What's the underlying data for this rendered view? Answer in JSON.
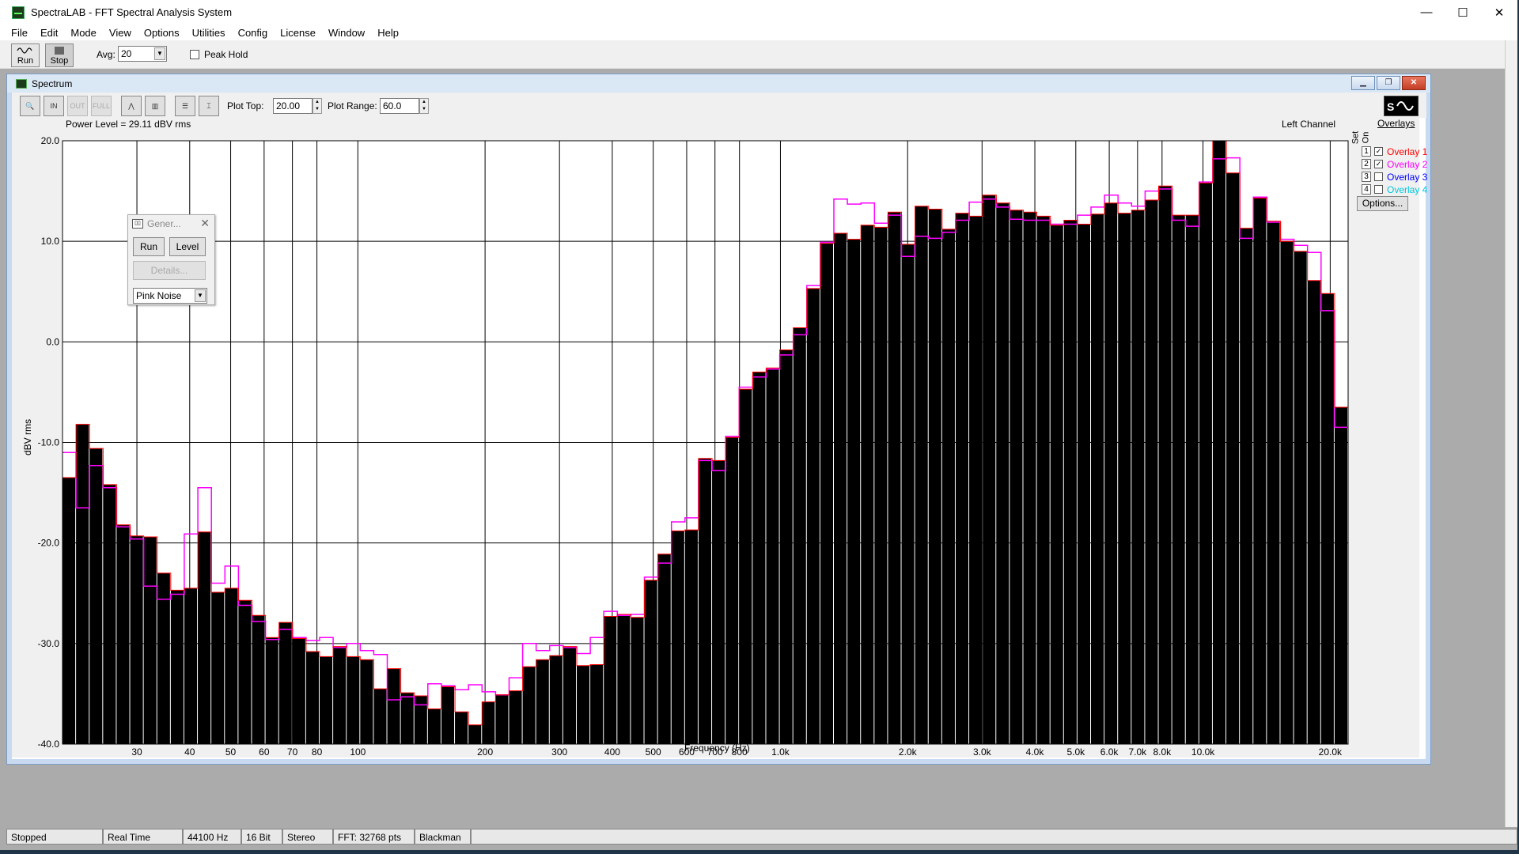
{
  "app": {
    "title": "SpectraLAB - FFT Spectral Analysis System",
    "window_controls": [
      "—",
      "☐",
      "✕"
    ]
  },
  "menu": [
    "File",
    "Edit",
    "Mode",
    "View",
    "Options",
    "Utilities",
    "Config",
    "License",
    "Window",
    "Help"
  ],
  "toolbar": {
    "run_label": "Run",
    "stop_label": "Stop",
    "avg_label": "Avg:",
    "avg_value": "20",
    "peak_hold_label": "Peak Hold",
    "peak_hold_checked": false
  },
  "spectrum_window": {
    "title": "Spectrum",
    "plot_top_label": "Plot Top:",
    "plot_top_value": "20.00",
    "plot_range_label": "Plot Range:",
    "plot_range_value": "60.0",
    "power_level": "Power Level = 29.11 dBV rms",
    "channel": "Left Channel",
    "buttons": [
      {
        "name": "zoom-icon",
        "label": "🔍"
      },
      {
        "name": "zoom-in-icon",
        "label": "IN"
      },
      {
        "name": "zoom-out-icon",
        "label": "OUT",
        "disabled": true
      },
      {
        "name": "zoom-full-icon",
        "label": "FULL",
        "disabled": true
      },
      {
        "name": "peak-icon",
        "label": "⋀"
      },
      {
        "name": "bar-icon",
        "label": "▥"
      },
      {
        "name": "list-icon",
        "label": "☰"
      },
      {
        "name": "marker-icon",
        "label": "⌶"
      }
    ]
  },
  "generator": {
    "title": "Gener...",
    "run_label": "Run",
    "level_label": "Level",
    "details_label": "Details...",
    "signal": "Pink Noise"
  },
  "overlays": {
    "header": "Overlays",
    "col_set": "Set",
    "col_on": "On",
    "items": [
      {
        "num": "1",
        "label": "Overlay 1",
        "checked": true,
        "color": "#ff0000"
      },
      {
        "num": "2",
        "label": "Overlay 2",
        "checked": true,
        "color": "#ff00ff"
      },
      {
        "num": "3",
        "label": "Overlay 3",
        "checked": false,
        "color": "#0000ff"
      },
      {
        "num": "4",
        "label": "Overlay 4",
        "checked": false,
        "color": "#00c8e0"
      }
    ],
    "options_label": "Options..."
  },
  "chart_data": {
    "type": "bar",
    "title": "",
    "xlabel": "Frequency (Hz)",
    "ylabel": "dBV rms",
    "x_scale": "log",
    "xlim": [
      20,
      22050
    ],
    "ylim": [
      -40,
      20
    ],
    "y_ticks": [
      "20.0",
      "10.0",
      "0.0",
      "-10.0",
      "-20.0",
      "-30.0",
      "-40.0"
    ],
    "x_ticks": [
      {
        "f": 30,
        "label": "30"
      },
      {
        "f": 40,
        "label": "40"
      },
      {
        "f": 50,
        "label": "50"
      },
      {
        "f": 60,
        "label": "60"
      },
      {
        "f": 70,
        "label": "70"
      },
      {
        "f": 80,
        "label": "80"
      },
      {
        "f": 100,
        "label": "100"
      },
      {
        "f": 200,
        "label": "200"
      },
      {
        "f": 300,
        "label": "300"
      },
      {
        "f": 400,
        "label": "400"
      },
      {
        "f": 500,
        "label": "500"
      },
      {
        "f": 600,
        "label": "600"
      },
      {
        "f": 700,
        "label": "700"
      },
      {
        "f": 800,
        "label": "800"
      },
      {
        "f": 1000,
        "label": "1.0k"
      },
      {
        "f": 2000,
        "label": "2.0k"
      },
      {
        "f": 3000,
        "label": "3.0k"
      },
      {
        "f": 4000,
        "label": "4.0k"
      },
      {
        "f": 5000,
        "label": "5.0k"
      },
      {
        "f": 6000,
        "label": "6.0k"
      },
      {
        "f": 7000,
        "label": "7.0k"
      },
      {
        "f": 8000,
        "label": "8.0k"
      },
      {
        "f": 10000,
        "label": "10.0k"
      },
      {
        "f": 20000,
        "label": "20.0k"
      }
    ],
    "bar_color": "#000000",
    "series": [
      {
        "name": "Spectrum",
        "values": [
          -13.5,
          -8.2,
          -10.6,
          -14.2,
          -18.2,
          -19.3,
          -19.4,
          -23.0,
          -24.7,
          -24.5,
          -18.9,
          -24.9,
          -24.5,
          -25.7,
          -27.2,
          -29.4,
          -27.9,
          -29.5,
          -30.8,
          -31.3,
          -30.3,
          -31.3,
          -31.6,
          -34.5,
          -32.5,
          -34.9,
          -35.2,
          -36.5,
          -34.3,
          -36.8,
          -38.1,
          -35.8,
          -35.1,
          -34.7,
          -32.3,
          -31.6,
          -31.2,
          -30.3,
          -32.2,
          -32.1,
          -27.3,
          -27.1,
          -27.4,
          -23.7,
          -21.1,
          -18.8,
          -18.7,
          -11.6,
          -11.8,
          -9.5,
          -4.7,
          -3.0,
          -2.6,
          -0.8,
          1.4,
          5.3,
          9.8,
          10.8,
          10.2,
          11.6,
          11.4,
          12.9,
          9.7,
          13.5,
          13.2,
          11.2,
          12.8,
          12.5,
          14.6,
          13.8,
          13.1,
          12.9,
          12.5,
          11.6,
          12.1,
          11.7,
          12.7,
          13.8,
          12.8,
          13.1,
          14.1,
          15.5,
          12.6,
          12.6,
          15.8,
          20.0,
          16.8,
          11.3,
          14.3,
          12.0,
          10.0,
          9.0,
          6.1,
          4.8,
          -6.5
        ]
      },
      {
        "name": "Overlay 2",
        "values": [
          -11.0,
          -16.5,
          -12.3,
          -14.5,
          -18.4,
          -19.6,
          -24.3,
          -25.6,
          -25.1,
          -19.1,
          -14.5,
          -24.0,
          -22.3,
          -26.2,
          -27.8,
          -29.6,
          -28.6,
          -29.4,
          -29.7,
          -29.4,
          -30.4,
          -30.0,
          -30.7,
          -31.1,
          -35.6,
          -35.3,
          -36.1,
          -34.0,
          -34.2,
          -34.6,
          -34.1,
          -34.8,
          -35.1,
          -33.4,
          -30.0,
          -30.7,
          -30.2,
          -30.4,
          -31.0,
          -29.4,
          -26.8,
          -27.2,
          -27.1,
          -23.4,
          -22.0,
          -17.9,
          -17.5,
          -11.8,
          -12.8,
          -9.4,
          -4.5,
          -3.5,
          -2.7,
          -1.3,
          0.7,
          5.6,
          9.9,
          14.2,
          13.7,
          13.8,
          11.8,
          12.6,
          8.5,
          10.5,
          10.3,
          10.9,
          12.1,
          13.9,
          14.2,
          13.4,
          12.2,
          12.1,
          12.1,
          11.7,
          11.7,
          12.6,
          13.4,
          14.6,
          13.8,
          13.5,
          15.0,
          15.2,
          12.1,
          11.5,
          15.9,
          18.2,
          18.3,
          10.3,
          14.4,
          11.9,
          10.2,
          9.6,
          8.9,
          3.1,
          -8.5
        ]
      }
    ],
    "grid": true,
    "channel": "Left Channel"
  },
  "statusbar": [
    "Stopped",
    "Real Time",
    "44100 Hz",
    "16 Bit",
    "Stereo",
    "FFT: 32768 pts",
    "Blackman"
  ]
}
